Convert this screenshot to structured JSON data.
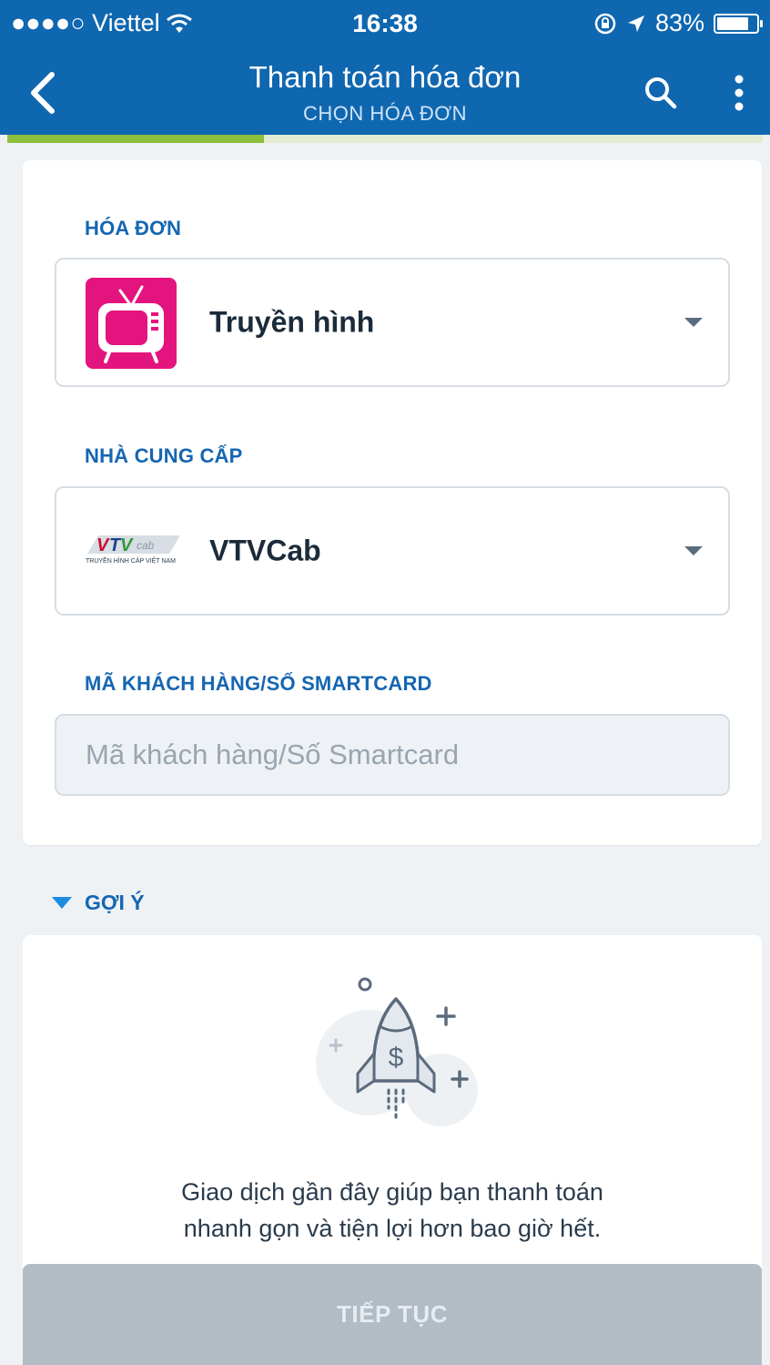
{
  "status_bar": {
    "carrier": "●●●●○ Viettel",
    "time": "16:38",
    "battery": "83%",
    "battery_level": 0.83
  },
  "header": {
    "title": "Thanh toán hóa đơn",
    "subtitle": "CHỌN HÓA ĐƠN",
    "step_progress": 0.34,
    "background": "#0f67b0",
    "icons": [
      "chevron-left-icon",
      "search-icon",
      "more-vertical-icon"
    ]
  },
  "form": {
    "bill_label": "HÓA ĐƠN",
    "bill_value": "Truyền hình",
    "bill_icon": "tv-icon",
    "provider_label": "NHÀ CUNG CẤP",
    "provider_value": "VTVCab",
    "provider_logo_text": "TRUYỀN HÌNH CÁP VIỆT NAM",
    "customer_label": "MÃ KHÁCH HÀNG/SỐ SMARTCARD",
    "customer_placeholder": "Mã khách hàng/Số Smartcard",
    "customer_value": ""
  },
  "suggestion": {
    "title": "GỢI Ý",
    "icon": "rocket-dollar-icon",
    "text_line1": "Giao dịch gần đây giúp bạn thanh toán",
    "text_line2": "nhanh gọn và tiện lợi hơn bao giờ hết."
  },
  "footer": {
    "continue_label": "TIẾP TỤC"
  },
  "colors": {
    "accent": "#1566b2",
    "progress": "#8bbf3c",
    "tv_icon": "#e4147e",
    "disabled_button": "#b1bcc5"
  }
}
